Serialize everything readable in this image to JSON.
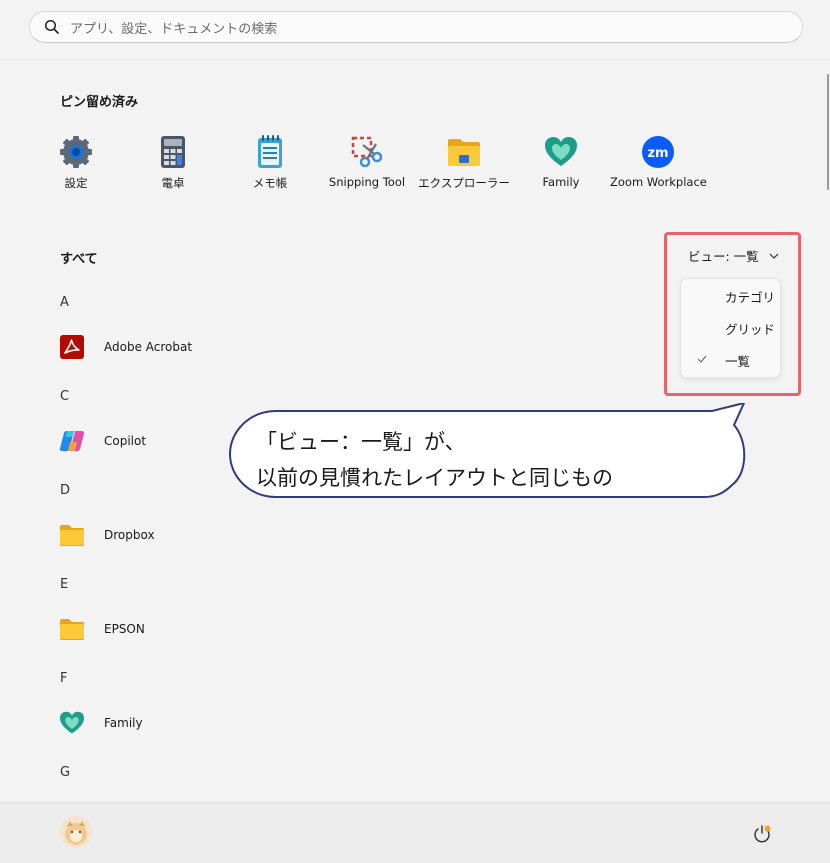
{
  "search": {
    "placeholder": "アプリ、設定、ドキュメントの検索",
    "icon": "search-icon"
  },
  "pinned": {
    "title": "ピン留め済み",
    "items": [
      {
        "label": "設定",
        "icon": "gear-icon"
      },
      {
        "label": "電卓",
        "icon": "calculator-icon"
      },
      {
        "label": "メモ帳",
        "icon": "notepad-icon"
      },
      {
        "label": "Snipping Tool",
        "icon": "snipping-tool-icon"
      },
      {
        "label": "エクスプローラー",
        "icon": "folder-icon"
      },
      {
        "label": "Family",
        "icon": "family-heart-icon"
      },
      {
        "label": "Zoom Workplace",
        "icon": "zoom-icon"
      }
    ]
  },
  "all_apps": {
    "title": "すべて",
    "groups": [
      {
        "letter": "A",
        "apps": [
          {
            "name": "Adobe Acrobat",
            "icon": "acrobat-icon"
          }
        ]
      },
      {
        "letter": "C",
        "apps": [
          {
            "name": "Copilot",
            "icon": "copilot-icon"
          }
        ]
      },
      {
        "letter": "D",
        "apps": [
          {
            "name": "Dropbox",
            "icon": "folder-icon"
          }
        ]
      },
      {
        "letter": "E",
        "apps": [
          {
            "name": "EPSON",
            "icon": "folder-icon"
          }
        ]
      },
      {
        "letter": "F",
        "apps": [
          {
            "name": "Family",
            "icon": "family-heart-icon"
          }
        ]
      },
      {
        "letter": "G",
        "apps": []
      }
    ]
  },
  "view_menu": {
    "button_label": "ビュー: 一覧",
    "options": [
      "カテゴリ",
      "グリッド",
      "一覧"
    ],
    "selected": "一覧"
  },
  "callout": {
    "line1": "「ビュー：一覧」が、",
    "line2": "以前の見慣れたレイアウトと同じもの"
  },
  "colors": {
    "highlight": "#e2666a",
    "callout_border": "#2f3d7a"
  },
  "footer": {
    "avatar_icon": "user-avatar",
    "power_icon": "power-icon"
  }
}
